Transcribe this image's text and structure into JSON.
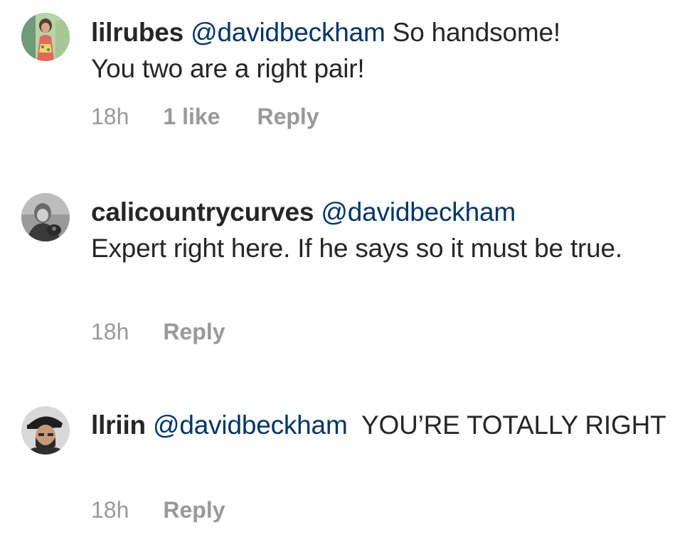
{
  "comments": [
    {
      "username": "lilrubes",
      "mention": "@davidbeckham",
      "text_line1": " So handsome!",
      "text_line2": "You two are a right pair!",
      "time": "18h",
      "likes": "1 like",
      "reply": "Reply",
      "avatar_icon": "user-avatar-photo"
    },
    {
      "username": "calicountrycurves",
      "mention": "@davidbeckham",
      "text_line1": "",
      "text_line2": "Expert right here. If he says so it must be true.",
      "time": "18h",
      "reply": "Reply",
      "avatar_icon": "user-avatar-photo"
    },
    {
      "username": "llriin",
      "mention": "@davidbeckham",
      "text_line1": "  YOU’RE TOTALLY RIGHT",
      "time": "18h",
      "reply": "Reply",
      "avatar_icon": "user-avatar-photo"
    }
  ],
  "colors": {
    "username": "#262626",
    "mention": "#003569",
    "meta": "#999999"
  }
}
